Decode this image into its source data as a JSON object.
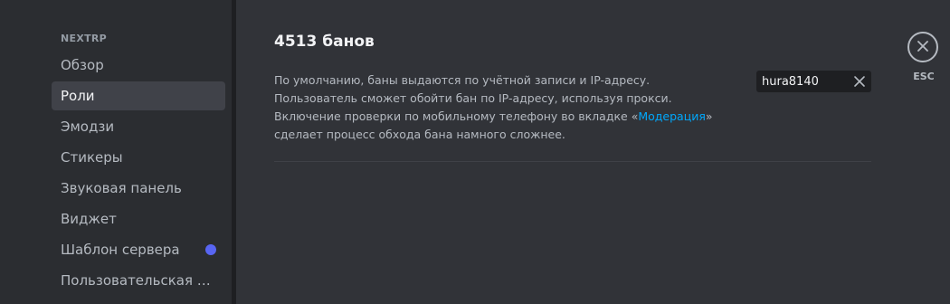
{
  "sidebar": {
    "header": "NEXTRP",
    "items": [
      {
        "label": "Обзор",
        "selected": false
      },
      {
        "label": "Роли",
        "selected": true
      },
      {
        "label": "Эмодзи",
        "selected": false
      },
      {
        "label": "Стикеры",
        "selected": false
      },
      {
        "label": "Звуковая панель",
        "selected": false
      },
      {
        "label": "Виджет",
        "selected": false
      },
      {
        "label": "Шаблон сервера",
        "selected": false,
        "badge": "dot"
      },
      {
        "label": "Пользовательская сс...",
        "selected": false
      }
    ]
  },
  "main": {
    "title": "4513 банов",
    "description_part1": "По умолчанию, баны выдаются по учётной записи и IP-адресу. Пользователь сможет обойти бан по IP-адресу, используя прокси. Включение проверки по мобильному телефону во вкладке «",
    "description_link": "Модерация",
    "description_part2": "» сделает процесс обхода бана намного сложнее.",
    "search": {
      "value": "hura8140",
      "clear_icon": "close-icon"
    }
  },
  "close": {
    "label": "ESC",
    "icon": "close-circle-icon"
  },
  "colors": {
    "accent": "#5865f2",
    "link": "#00a8fc",
    "background": "#313338",
    "sidebar": "#2b2d31"
  }
}
